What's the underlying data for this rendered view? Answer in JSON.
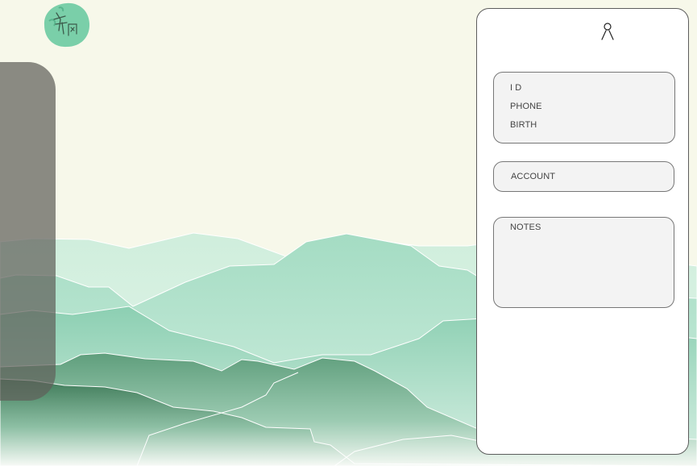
{
  "logo": {
    "icon": "ink-seal-logo-icon",
    "color": "#6ccaa2"
  },
  "profile": {
    "icon": "user-icon"
  },
  "form": {
    "id_label": "I D",
    "phone_label": "PHONE",
    "birth_label": "BIRTH",
    "account_label": "ACCOUNT",
    "notes_label": "NOTES"
  },
  "theme": {
    "background": "#f7f8ea",
    "mountain_light": "#c8ecd6",
    "mountain_mid": "#9fd8bd",
    "mountain_dark": "#4e8a66",
    "panel_overlay": "#5f605a",
    "card_bg": "#ffffff",
    "field_bg": "#f3f3f3"
  }
}
